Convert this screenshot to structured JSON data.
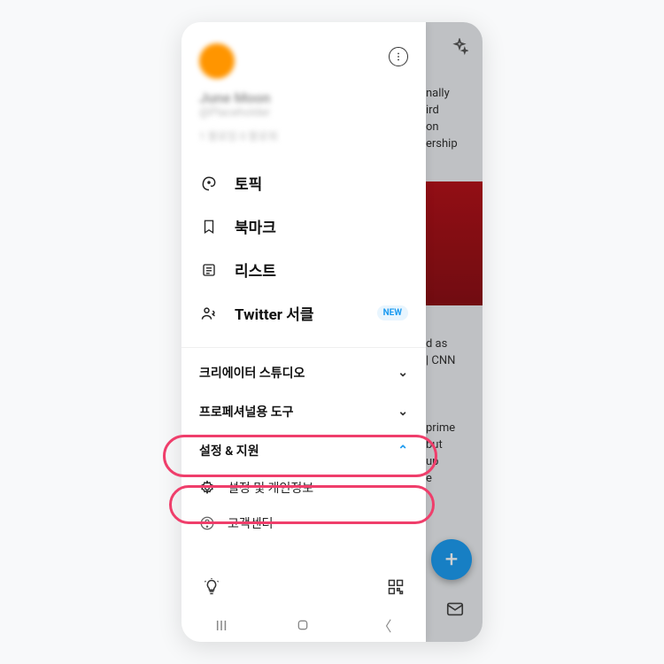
{
  "profile": {
    "name": "June Moon",
    "handle": "@Placeholder",
    "stats": "1 팔로잉 0 팔로워"
  },
  "nav": {
    "topics": "토픽",
    "bookmarks": "북마크",
    "lists": "리스트",
    "circle": "Twitter 서클",
    "new_badge": "NEW"
  },
  "sections": {
    "creator_studio": "크리에이터 스튜디오",
    "pro_tools": "프로페셔널용 도구",
    "settings_support": "설정 & 지원"
  },
  "sub": {
    "settings_privacy": "설정 및 개인정보",
    "help_center": "고객센터"
  },
  "bg": {
    "t1": "nally\nird\non\nership",
    "t2": "d as\n| CNN",
    "t3": "prime\nbut\nup\ne"
  },
  "icons": {
    "sparkle": "sparkle",
    "menu": "more",
    "plus": "+"
  }
}
